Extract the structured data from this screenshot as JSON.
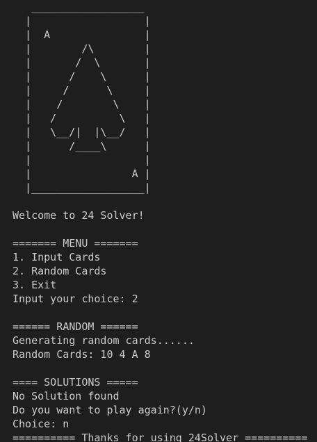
{
  "colors": {
    "background": "#1e1e1e",
    "text": "#cccccc"
  },
  "terminal": {
    "art_lines": [
      "   __________________",
      "  |                  |",
      "  |  A               |",
      "  |        /\\        |",
      "  |       /  \\       |",
      "  |      /    \\      |",
      "  |     /      \\     |",
      "  |    /        \\    |",
      "  |   /          \\   |",
      "  |   \\__/|  |\\__/   |",
      "  |      /____\\      |",
      "  |                  |",
      "  |                A |",
      "  |__________________|"
    ],
    "output_lines": [
      "",
      "Welcome to 24 Solver!",
      "",
      "======= MENU =======",
      "1. Input Cards",
      "2. Random Cards",
      "3. Exit",
      "Input your choice: 2",
      "",
      "====== RANDOM ======",
      "Generating random cards......",
      "Random Cards: 10 4 A 8",
      "",
      "==== SOLUTIONS =====",
      "No Solution found",
      "Do you want to play again?(y/n)",
      "Choice: n",
      "========== Thanks for using 24Solver =========="
    ]
  }
}
